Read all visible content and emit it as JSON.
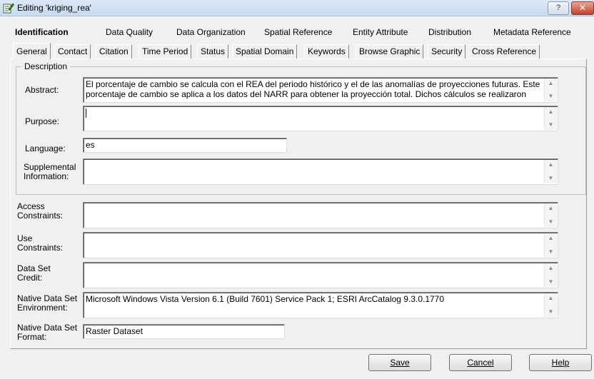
{
  "window": {
    "title": "Editing 'kriging_rea'",
    "help_glyph": "?",
    "close_glyph": "✕"
  },
  "main_tabs": [
    {
      "label": "Identification",
      "active": true
    },
    {
      "label": "Data Quality"
    },
    {
      "label": "Data Organization"
    },
    {
      "label": "Spatial Reference"
    },
    {
      "label": "Entity Attribute"
    },
    {
      "label": "Distribution"
    },
    {
      "label": "Metadata Reference"
    }
  ],
  "sub_tabs": [
    {
      "label": "General",
      "active": true
    },
    {
      "label": "Contact"
    },
    {
      "label": "Citation"
    },
    {
      "label": "Time Period"
    },
    {
      "label": "Status"
    },
    {
      "label": "Spatial Domain"
    },
    {
      "label": "Keywords"
    },
    {
      "label": "Browse Graphic"
    },
    {
      "label": "Security"
    },
    {
      "label": "Cross Reference"
    }
  ],
  "description": {
    "group_label": "Description",
    "abstract_label": "Abstract:",
    "abstract_value": "El porcentaje de cambio se calcula con el REA del periodo histórico y el de las anomalías de proyecciones futuras. Este porcentaje de cambio se aplica a los datos del NARR para obtener la proyección total. Dichos cálculos se realizaron",
    "purpose_label": "Purpose:",
    "purpose_value": "",
    "language_label": "Language:",
    "language_value": "es",
    "supplemental_label_1": "Supplemental",
    "supplemental_label_2": "Information:",
    "supplemental_value": ""
  },
  "access": {
    "label_1": "Access",
    "label_2": "Constraints:",
    "value": ""
  },
  "use": {
    "label_1": "Use",
    "label_2": "Constraints:",
    "value": ""
  },
  "credit": {
    "label_1": "Data Set",
    "label_2": "Credit:",
    "value": ""
  },
  "environment": {
    "label_1": "Native Data Set",
    "label_2": "Environment:",
    "value": "Microsoft Windows Vista Version 6.1 (Build 7601) Service Pack 1; ESRI ArcCatalog 9.3.0.1770"
  },
  "format": {
    "label_1": "Native Data Set",
    "label_2": "Format:",
    "value": "Raster Dataset"
  },
  "buttons": {
    "save": "Save",
    "cancel": "Cancel",
    "help": "Help"
  },
  "icons": {
    "scroll_up": "▲",
    "scroll_down": "▼"
  },
  "colors": {
    "title_bar": "#c9dbee",
    "close_button": "#c4412e",
    "window_bg": "#f0f0f0"
  }
}
